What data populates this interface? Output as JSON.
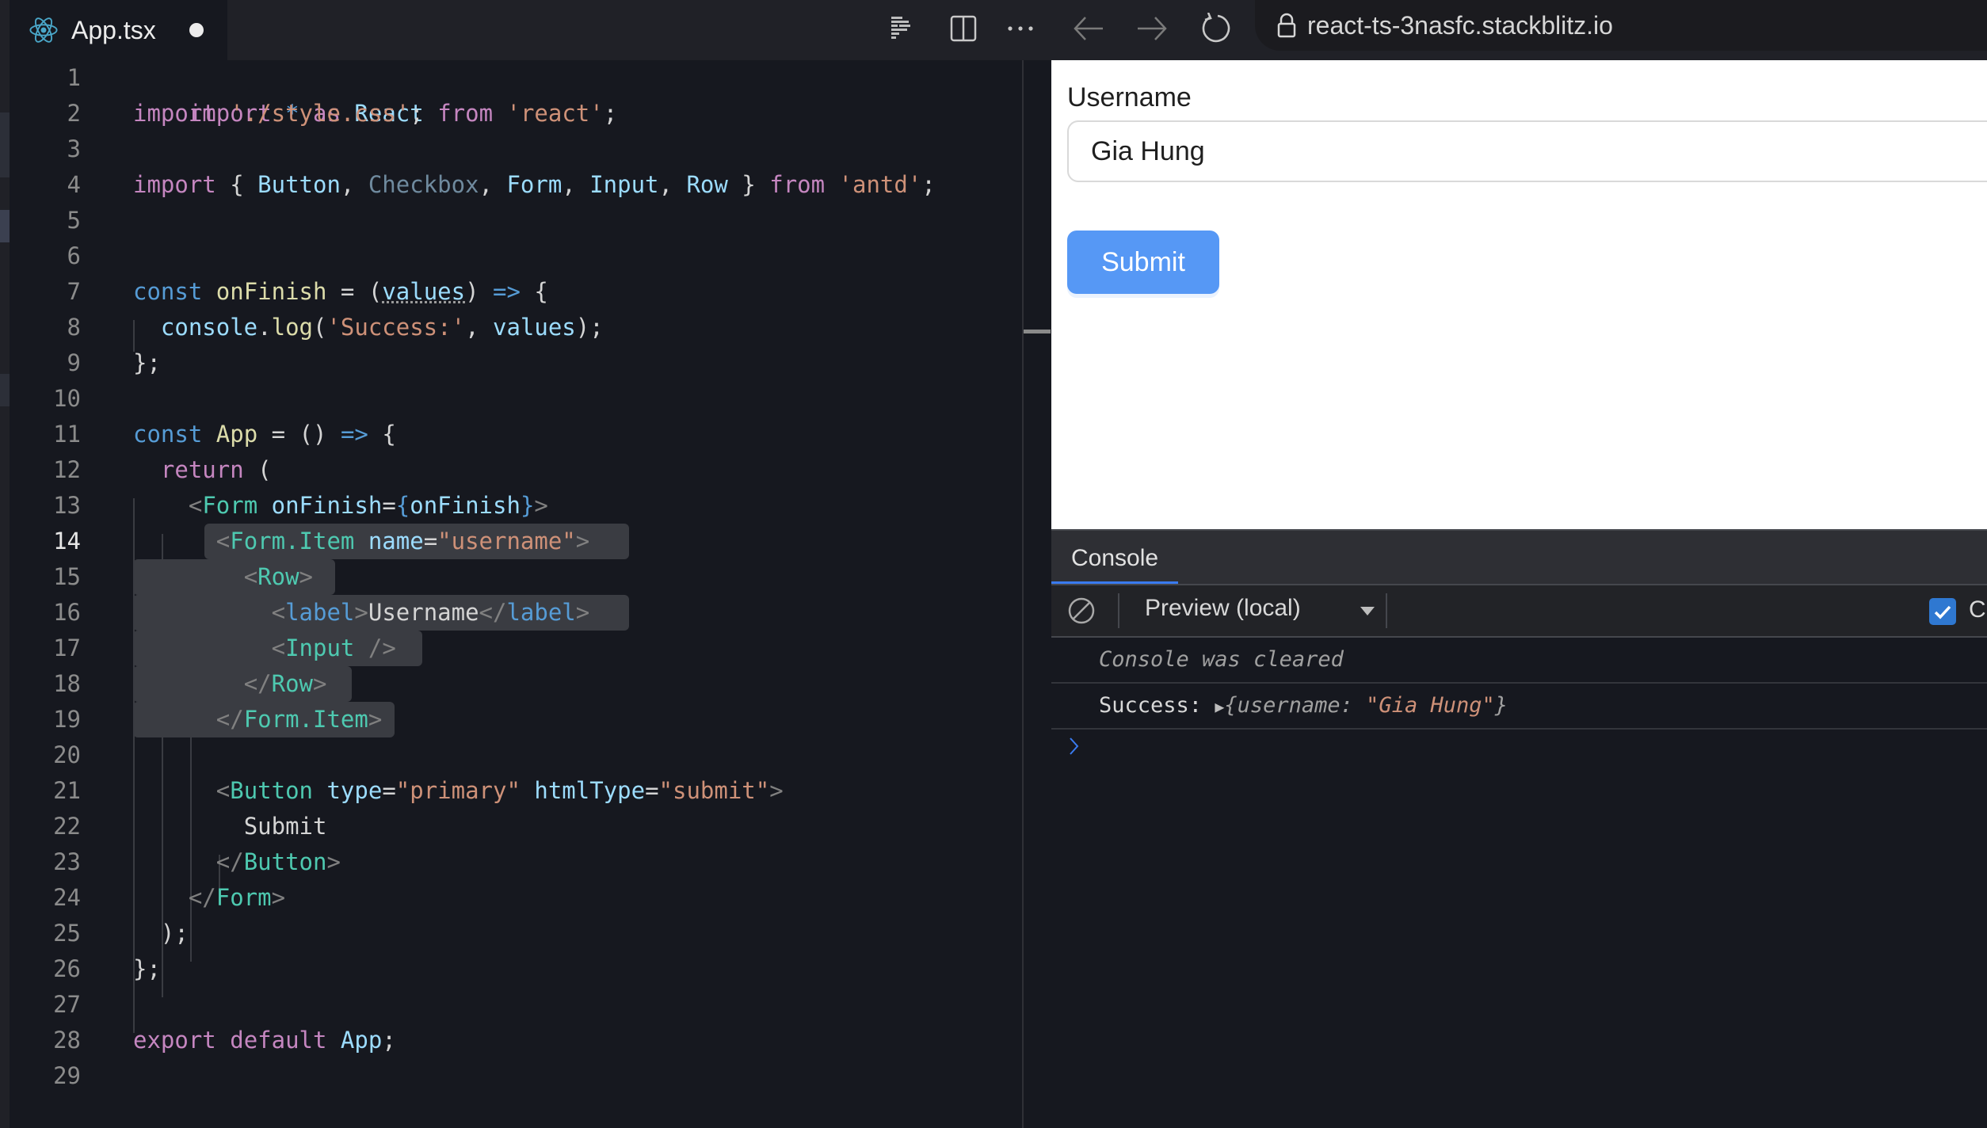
{
  "tab": {
    "filename": "App.tsx",
    "icon": "react-icon",
    "unsaved": true
  },
  "toolbar": {
    "icons": [
      "prettier-icon",
      "split-editor-icon",
      "more-icon",
      "back-icon",
      "forward-icon",
      "reload-icon"
    ],
    "url": "react-ts-3nasfc.stackblitz.io"
  },
  "editor": {
    "active_line": 14,
    "lines": [
      {
        "n": "1"
      },
      {
        "n": "2"
      },
      {
        "n": "3"
      },
      {
        "n": "4"
      },
      {
        "n": "5"
      },
      {
        "n": "6"
      },
      {
        "n": "7"
      },
      {
        "n": "8"
      },
      {
        "n": "9"
      },
      {
        "n": "10"
      },
      {
        "n": "11"
      },
      {
        "n": "12"
      },
      {
        "n": "13"
      },
      {
        "n": "14"
      },
      {
        "n": "15"
      },
      {
        "n": "16"
      },
      {
        "n": "17"
      },
      {
        "n": "18"
      },
      {
        "n": "19"
      },
      {
        "n": "20"
      },
      {
        "n": "21"
      },
      {
        "n": "22"
      },
      {
        "n": "23"
      },
      {
        "n": "24"
      },
      {
        "n": "25"
      },
      {
        "n": "26"
      },
      {
        "n": "27"
      },
      {
        "n": "28"
      },
      {
        "n": "29"
      }
    ],
    "tokens": {
      "l1": [
        "import",
        " ",
        "*",
        " ",
        "as",
        " ",
        "React",
        " ",
        "from",
        " ",
        "'react'",
        ";"
      ],
      "l2": [
        "import",
        " ",
        "'./style.css'",
        ";"
      ],
      "l4": [
        "import",
        " { ",
        "Button",
        ", ",
        "Checkbox",
        ", ",
        "Form",
        ", ",
        "Input",
        ", ",
        "Row",
        " } ",
        "from",
        " ",
        "'antd'",
        ";"
      ],
      "l7": [
        "const",
        " ",
        "onFinish",
        " = (",
        "values",
        ") ",
        "=>",
        " {"
      ],
      "l8": [
        "  ",
        "console",
        ".",
        "log",
        "(",
        "'Success:'",
        ", ",
        "values",
        ");"
      ],
      "l9": [
        "};"
      ],
      "l11": [
        "const",
        " ",
        "App",
        " = () ",
        "=>",
        " {"
      ],
      "l12": [
        "  ",
        "return",
        " ("
      ],
      "l13": [
        "    ",
        "<",
        "Form",
        " ",
        "onFinish",
        "=",
        "{",
        "onFinish",
        "}",
        ">"
      ],
      "l14": [
        "      ",
        "<",
        "Form.Item",
        " ",
        "name",
        "=",
        "\"username\"",
        ">"
      ],
      "l15": [
        "        ",
        "<",
        "Row",
        ">"
      ],
      "l16": [
        "          ",
        "<",
        "label",
        ">",
        "Username",
        "</",
        "label",
        ">"
      ],
      "l17": [
        "          ",
        "<",
        "Input",
        " ",
        "/>"
      ],
      "l18": [
        "        ",
        "</",
        "Row",
        ">"
      ],
      "l19": [
        "      ",
        "</",
        "Form.Item",
        ">"
      ],
      "l21": [
        "      ",
        "<",
        "Button",
        " ",
        "type",
        "=",
        "\"primary\"",
        " ",
        "htmlType",
        "=",
        "\"submit\"",
        ">"
      ],
      "l22": [
        "        ",
        "Submit"
      ],
      "l23": [
        "      ",
        "</",
        "Button",
        ">"
      ],
      "l24": [
        "    ",
        "</",
        "Form",
        ">"
      ],
      "l25": [
        "  ",
        ");"
      ],
      "l26": [
        "};"
      ],
      "l28": [
        "export",
        " ",
        "default",
        " ",
        "App",
        ";"
      ]
    }
  },
  "preview": {
    "label": "Username",
    "input_value": "Gia Hung",
    "submit_label": "Submit",
    "button_color": "#5698f5"
  },
  "console": {
    "tab_label": "Console",
    "context_select": "Preview (local)",
    "checkbox_label": "Cl",
    "checkbox_checked": true,
    "logs": [
      {
        "text": "Console was cleared",
        "style": "italic-muted"
      },
      {
        "prefix": "Success:",
        "obj_key": "{username: ",
        "obj_value": "\"Gia Hung\"",
        "obj_end": "}"
      }
    ],
    "prompt_icon": "chevron-right-icon"
  },
  "colors": {
    "editor_bg": "#16181f",
    "keyword": "#c586c0",
    "string": "#ce9178",
    "tag": "#4ec9b0",
    "accent": "#3a7bf0"
  }
}
